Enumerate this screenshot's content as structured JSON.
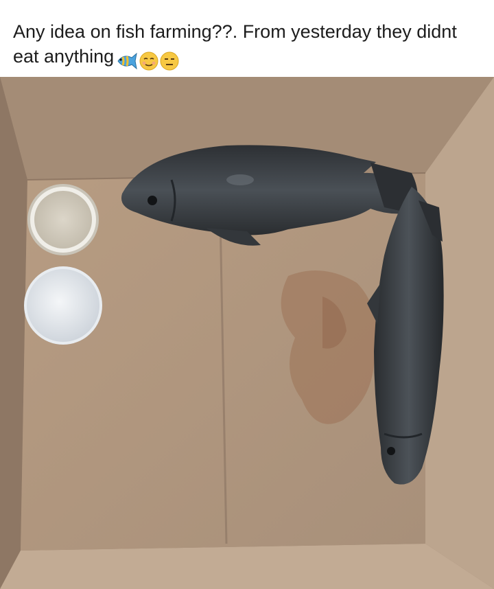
{
  "post": {
    "caption": "Any idea on fish farming??. From yesterday they didnt eat anything",
    "caption_emojis": [
      "tropical-fish-emoji",
      "relieved-face-emoji",
      "expressionless-face-emoji"
    ]
  },
  "photo": {
    "subject": "two fish lying in a cardboard box beside two small bowls",
    "colors": {
      "cardboard": "#b49a80",
      "fish": "#3a3e42",
      "stain": "#9a6a4e"
    }
  }
}
